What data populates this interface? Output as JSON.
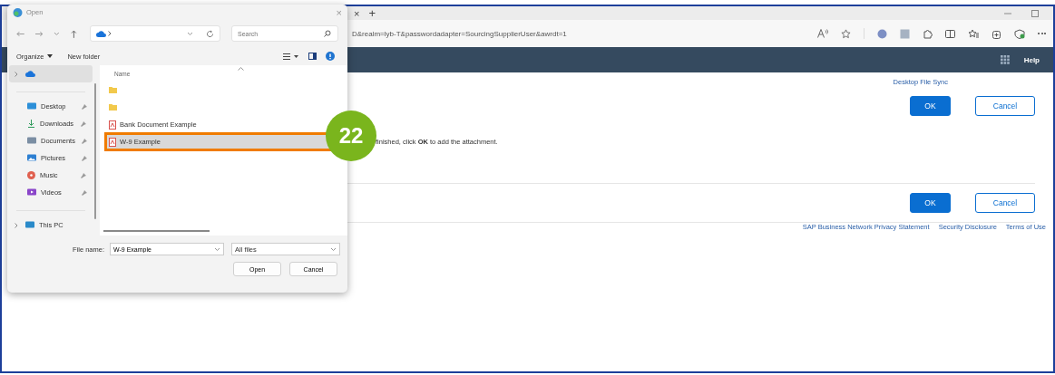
{
  "browser": {
    "tab_close": "×",
    "new_tab": "+",
    "url": "D&realm=lyb-T&passwordadapter=SourcingSupplierUser&awrdt=1",
    "header_link": "Help",
    "sync_link": "Desktop File Sync",
    "top_buttons": [
      {
        "label": "OK",
        "primary": true
      },
      {
        "label": "Cancel",
        "primary": false
      }
    ],
    "instruction": "finished, click **OK** to add the attachment.",
    "bottom_buttons": [
      {
        "label": "OK",
        "primary": true
      },
      {
        "label": "Cancel",
        "primary": false
      }
    ],
    "footer_links": [
      "SAP Business Network Privacy Statement",
      "Security Disclosure",
      "Terms of Use"
    ]
  },
  "dialog": {
    "title": "Open",
    "close": "×",
    "search": {
      "placeholder": "Search"
    },
    "toolbar": [
      "Organize",
      "New folder"
    ],
    "nav_items": [
      {
        "kind": "cloud",
        "selected": true,
        "pinned": false
      },
      {
        "kind": "desktop",
        "label": "Desktop",
        "selected": false,
        "pinned": true
      },
      {
        "kind": "download",
        "label": "Downloads",
        "selected": false,
        "pinned": true
      },
      {
        "kind": "documents",
        "label": "Documents",
        "selected": false,
        "pinned": true
      },
      {
        "kind": "pictures",
        "label": "Pictures",
        "selected": false,
        "pinned": true
      },
      {
        "kind": "music",
        "label": "Music",
        "selected": false,
        "pinned": true
      },
      {
        "kind": "videos",
        "label": "Videos",
        "selected": false,
        "pinned": true
      },
      {
        "kind": "pc",
        "label": "This PC",
        "selected": false,
        "pinned": false
      }
    ],
    "column": "Name",
    "files": [
      {
        "kind": "folder",
        "selected": false
      },
      {
        "kind": "folder",
        "selected": false
      },
      {
        "kind": "pdf",
        "name": "Bank Document Example",
        "selected": false
      },
      {
        "kind": "pdf",
        "name": "W-9 Example",
        "selected": true
      }
    ],
    "file_name_label": "File name:",
    "file_name": "W-9 Example",
    "filter": "All files",
    "buttons": [
      "Open",
      "Cancel"
    ]
  },
  "step_badge": "22"
}
